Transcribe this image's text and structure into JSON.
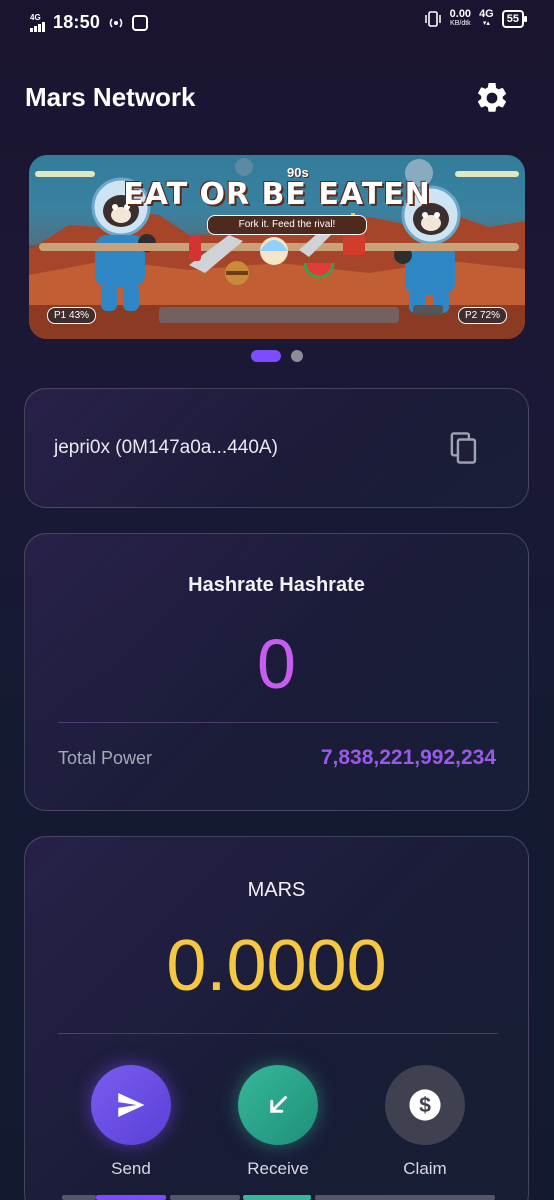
{
  "status_bar": {
    "signal_label": "4G",
    "time": "18:50",
    "net_speed_value": "0.00",
    "net_speed_unit": "KB/dtk",
    "net_type": "4G",
    "battery": "55"
  },
  "header": {
    "title": "Mars Network",
    "settings_icon": "gear-icon"
  },
  "banner": {
    "super_text": "90s",
    "title": "EAT OR BE EATEN",
    "subtitle": "Fork it. Feed the rival!",
    "player1": "P1 43%",
    "player2": "P2 72%",
    "player1_progress": 0.43,
    "player2_progress": 0.72,
    "page_count": 2,
    "active_page": 1
  },
  "wallet": {
    "address_display": "jepri0x (0M147a0a...440A)",
    "copy_icon": "copy-icon"
  },
  "hashrate": {
    "title": "Hashrate Hashrate",
    "value": "0",
    "total_power_label": "Total Power",
    "total_power_value": "7,838,221,992,234"
  },
  "mars": {
    "title": "MARS",
    "balance": "0.0000",
    "actions": [
      {
        "label": "Send",
        "icon": "send-icon"
      },
      {
        "label": "Receive",
        "icon": "arrow-down-left-icon"
      },
      {
        "label": "Claim",
        "icon": "dollar-coin-icon"
      }
    ]
  },
  "colors": {
    "accent_purple": "#7c4dff",
    "hashrate_value": "#c85cf0",
    "total_power": "#9b59e8",
    "balance_gold": "#f5c842",
    "receive_teal": "#35b89a"
  }
}
